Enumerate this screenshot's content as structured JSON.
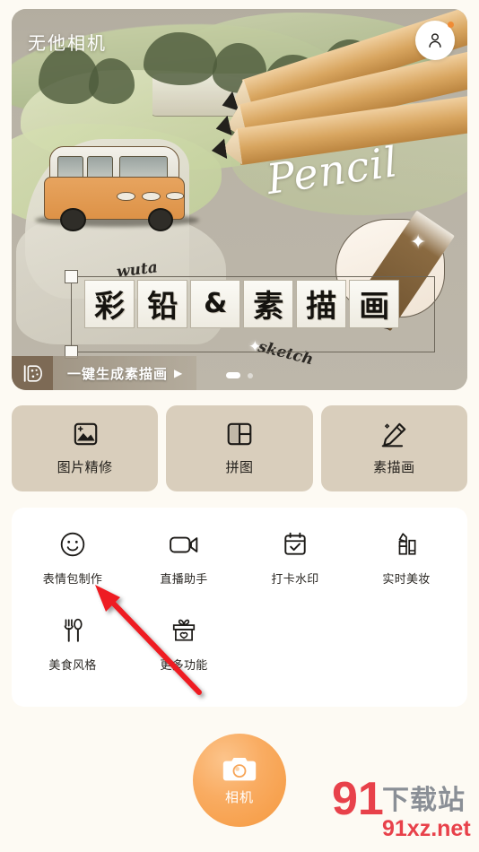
{
  "app": {
    "title": "无他相机",
    "avatar_icon": "person-icon",
    "has_notification_dot": true
  },
  "banner": {
    "headline_chars": [
      "彩",
      "铅",
      "&",
      "素",
      "描",
      "画"
    ],
    "script_word": "Pencil",
    "deco_word_left": "wuta",
    "deco_word_right": "sketch",
    "cta": {
      "icon": "palette-brush-icon",
      "label": "一键生成素描画",
      "caret": "▶"
    },
    "pagination": {
      "total": 2,
      "active_index": 0
    }
  },
  "feature_cards": [
    {
      "label": "图片精修",
      "icon": "image-enhance-icon"
    },
    {
      "label": "拼图",
      "icon": "collage-grid-icon"
    },
    {
      "label": "素描画",
      "icon": "pencil-sketch-icon"
    }
  ],
  "grid": {
    "row1": [
      {
        "label": "表情包制作",
        "icon": "smiley-face-icon"
      },
      {
        "label": "直播助手",
        "icon": "video-camera-icon"
      },
      {
        "label": "打卡水印",
        "icon": "calendar-check-icon"
      },
      {
        "label": "实时美妆",
        "icon": "lipstick-icon"
      }
    ],
    "row2": [
      {
        "label": "美食风格",
        "icon": "fork-spoon-icon"
      },
      {
        "label": "更多功能",
        "icon": "gift-box-icon"
      }
    ]
  },
  "camera": {
    "label": "相机",
    "icon": "camera-icon",
    "accent_color": "#f6a154"
  },
  "watermark": {
    "logo_number": "91",
    "logo_text": "下载站",
    "domain": "91xz.net",
    "color_red": "#e8414a",
    "color_gray": "#8a8f96"
  },
  "annotation": {
    "type": "red-arrow",
    "color": "#ee1c23",
    "points_to": "表情包制作"
  },
  "colors": {
    "page_background": "#fdfaf3",
    "card_background": "#d9cebc",
    "panel_background": "#ffffff"
  }
}
